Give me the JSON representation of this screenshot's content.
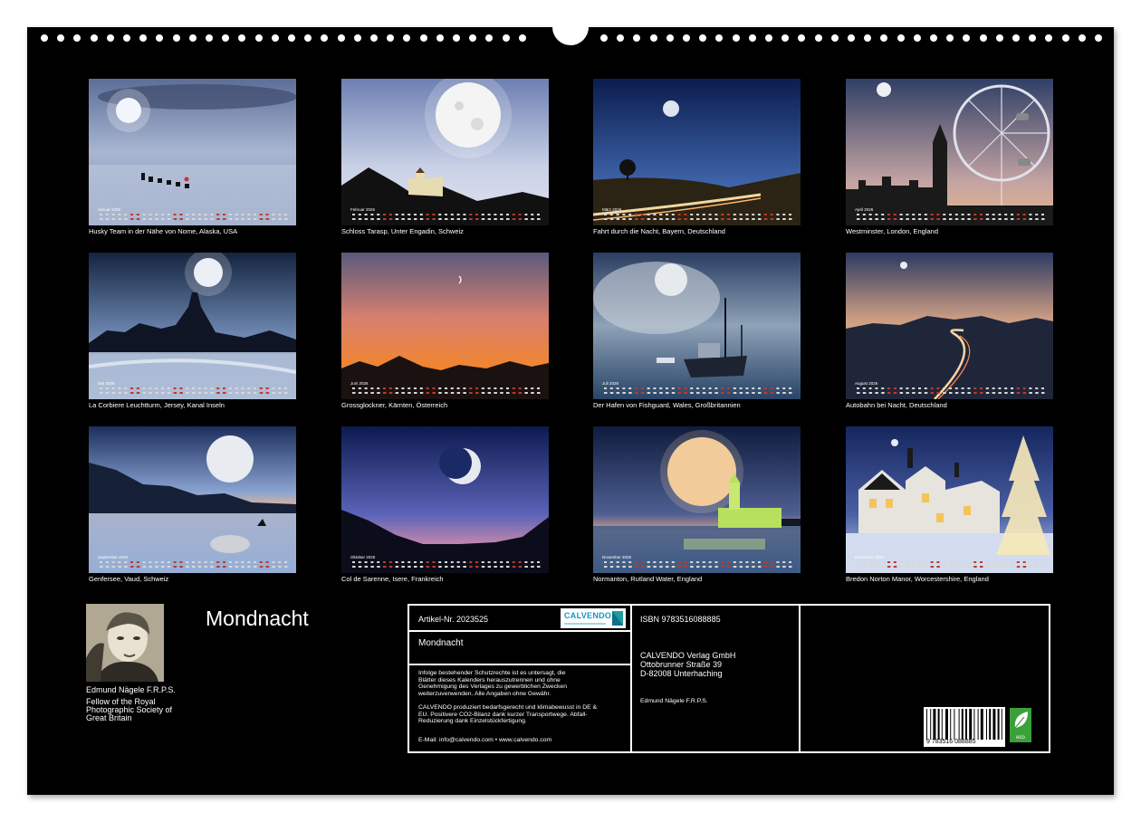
{
  "calendar": {
    "title": "Mondnacht",
    "months": [
      {
        "label": "Januar 2026",
        "caption": "Husky Team in der Nähe von Nome, Alaska, USA",
        "scene": "husky"
      },
      {
        "label": "Februar 2026",
        "caption": "Schloss Tarasp, Unter Engadin, Schweiz",
        "scene": "castle"
      },
      {
        "label": "März 2026",
        "caption": "Fahrt durch die Nacht, Bayern, Deutschland",
        "scene": "road"
      },
      {
        "label": "April 2026",
        "caption": "Westminster, London, England",
        "scene": "london"
      },
      {
        "label": "Mai 2026",
        "caption": "La Corbiere Leuchtturm, Jersey, Kanal Inseln",
        "scene": "lighthouse"
      },
      {
        "label": "Juni 2026",
        "caption": "Grossglockner, Kärnten, Österreich",
        "scene": "sunset"
      },
      {
        "label": "Juli 2026",
        "caption": "Der Hafen von Fishguard, Wales, Großbritannien",
        "scene": "harbour"
      },
      {
        "label": "August 2026",
        "caption": "Autobahn bei Nacht, Deutschland",
        "scene": "autobahn"
      },
      {
        "label": "September 2026",
        "caption": "Genfersee, Vaud, Schweiz",
        "scene": "lake"
      },
      {
        "label": "Oktober 2026",
        "caption": "Col de Sarenne, Isere, Frankreich",
        "scene": "crescent"
      },
      {
        "label": "November 2026",
        "caption": "Normanton, Rutland Water, England",
        "scene": "church"
      },
      {
        "label": "Dezember 2026",
        "caption": "Bredon Norton Manor, Worcestershire, England",
        "scene": "manor"
      }
    ]
  },
  "author": {
    "name": "Edmund Nägele F.R.P.S.",
    "title_lines": [
      "Fellow of the Royal",
      "Photographic Society of",
      "Great Britain"
    ]
  },
  "info": {
    "article": "Artikel-Nr. 2023525",
    "logo": "CALVENDO",
    "product_title": "Mondnacht",
    "legal_1": [
      "Infolge bestehender Schutzrechte ist es untersagt, die",
      "Blätter dieses Kalenders herauszutrennen und ohne",
      "Genehmigung des Verlages zu gewerblichen Zwecken",
      "weiterzuverwenden. Alle Angaben ohne Gewähr."
    ],
    "legal_2": [
      "CALVENDO produziert bedarfsgerecht und klimabewusst in DE &",
      "EU. Positivere CO2-Bilanz dank kurzer Transportwege. Abfall-",
      "Reduzierung dank Einzelstückfertigung."
    ],
    "contact": "E-Mail: info@calvendo.com • www.calvendo.com",
    "isbn": "ISBN 9783516088885",
    "publisher_lines": [
      "CALVENDO Verlag GmbH",
      "Ottobrunner Straße 39",
      "D-82008 Unterhaching"
    ],
    "photographer": "Edmund Nägele F.R.P.S.",
    "barcode_number": "9 783516 088885",
    "eco_label": "eco"
  }
}
